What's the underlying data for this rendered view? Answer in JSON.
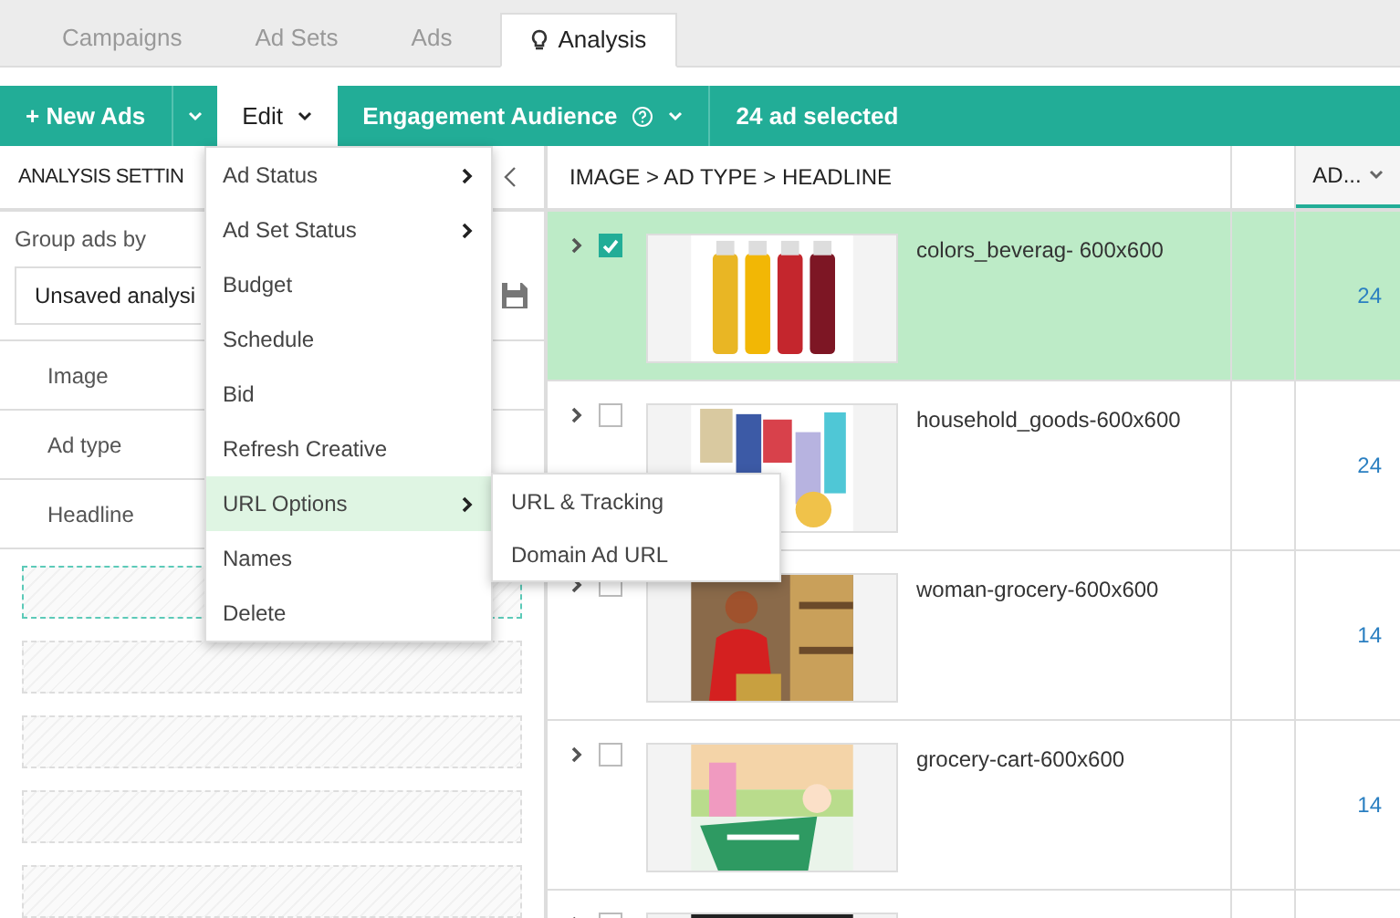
{
  "tabs": [
    {
      "label": "Campaigns",
      "selected": false,
      "icon": false
    },
    {
      "label": "Ad Sets",
      "selected": false,
      "icon": false
    },
    {
      "label": "Ads",
      "selected": false,
      "icon": false
    },
    {
      "label": "Analysis",
      "selected": true,
      "icon": true
    }
  ],
  "toolbar": {
    "new_ads": "+ New Ads",
    "edit": "Edit",
    "audience": "Engagement Audience",
    "selection": "24 ad selected"
  },
  "left_panel": {
    "title": "ANALYSIS SETTIN",
    "group_label": "Group ads by",
    "analysis_value": "Unsaved analysi",
    "fields": [
      "Image",
      "Ad type",
      "Headline"
    ],
    "slots": [
      {
        "highlighted": true
      },
      {
        "highlighted": false
      },
      {
        "highlighted": false
      },
      {
        "highlighted": false
      },
      {
        "highlighted": false
      }
    ]
  },
  "edit_menu": [
    {
      "label": "Ad Status",
      "submenu": true,
      "selected": false
    },
    {
      "label": "Ad Set Status",
      "submenu": true,
      "selected": false
    },
    {
      "label": "Budget",
      "submenu": false,
      "selected": false
    },
    {
      "label": "Schedule",
      "submenu": false,
      "selected": false
    },
    {
      "label": "Bid",
      "submenu": false,
      "selected": false
    },
    {
      "label": "Refresh Creative",
      "submenu": false,
      "selected": false
    },
    {
      "label": "URL Options",
      "submenu": true,
      "selected": true
    },
    {
      "label": "Names",
      "submenu": false,
      "selected": false
    },
    {
      "label": "Delete",
      "submenu": false,
      "selected": false
    }
  ],
  "submenu": [
    "URL & Tracking",
    "Domain Ad URL"
  ],
  "table": {
    "columns": [
      "IMAGE > AD TYPE > HEADLINE",
      "AD..."
    ],
    "rows": [
      {
        "name": "colors_beverag- 600x600",
        "value": "24",
        "checked": true,
        "selected": true,
        "kind": "picture"
      },
      {
        "name": "household_goods-600x600",
        "value": "24",
        "checked": false,
        "selected": false,
        "kind": "picture"
      },
      {
        "name": "woman-grocery-600x600",
        "value": "14",
        "checked": false,
        "selected": false,
        "kind": "picture"
      },
      {
        "name": "grocery-cart-600x600",
        "value": "14",
        "checked": false,
        "selected": false,
        "kind": "picture"
      },
      {
        "checked": false,
        "selected": false,
        "kind": "picture"
      }
    ]
  }
}
